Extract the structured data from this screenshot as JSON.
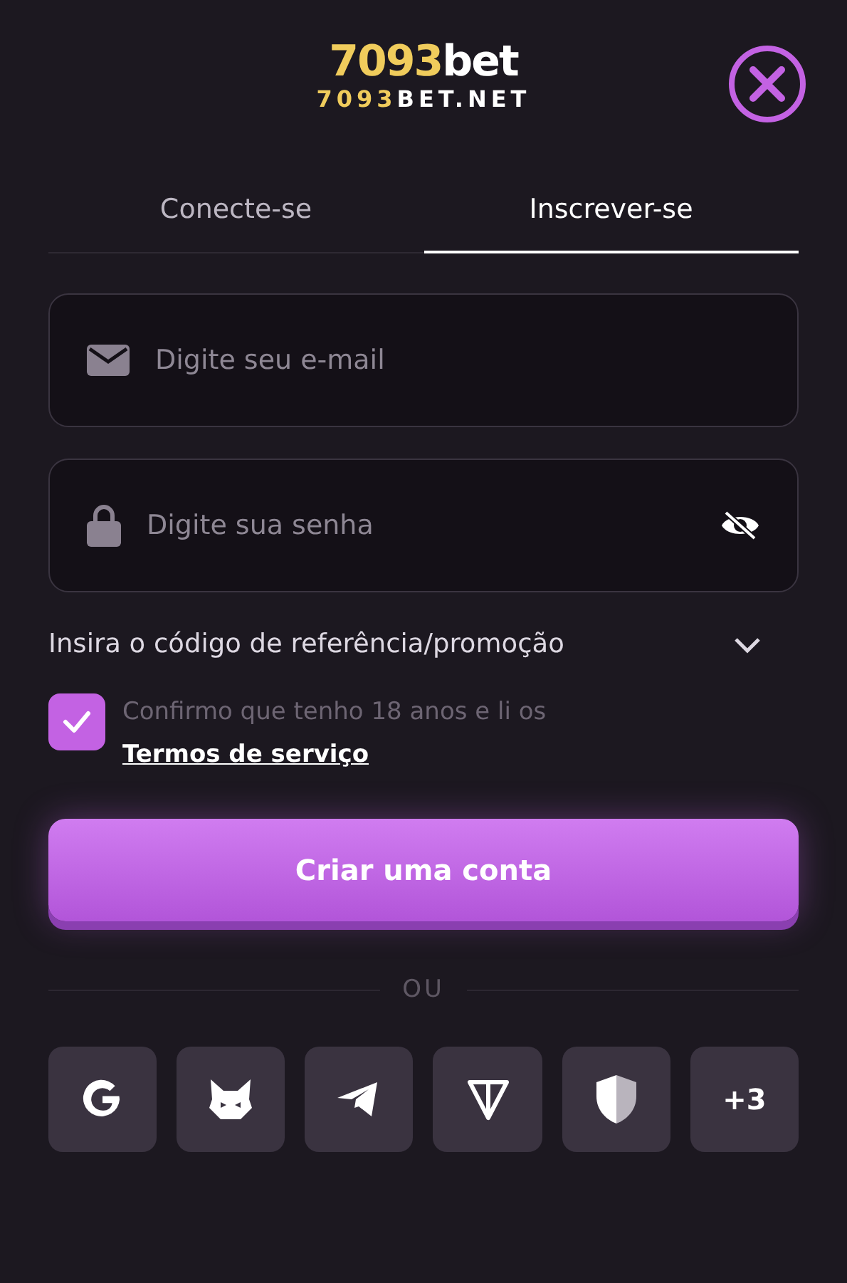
{
  "logo": {
    "brand_number": "7093",
    "brand_suffix": "bet",
    "domain_number": "7093",
    "domain_suffix": "BET.NET"
  },
  "tabs": [
    {
      "label": "Conecte-se",
      "selected": false
    },
    {
      "label": "Inscrever-se",
      "selected": true
    }
  ],
  "fields": [
    {
      "kind": "email",
      "placeholder": "Digite seu e-mail"
    },
    {
      "kind": "password",
      "placeholder": "Digite sua senha"
    }
  ],
  "referral": {
    "label": "Insira o código de referência/promoção",
    "expanded": false
  },
  "consent": {
    "checked": true,
    "text": "Confirmo que tenho 18 anos e li os",
    "link": "Termos de serviço"
  },
  "submit_button": "Criar uma conta",
  "divider_text": "OU",
  "social": [
    {
      "kind": "google"
    },
    {
      "kind": "fox"
    },
    {
      "kind": "telegram"
    },
    {
      "kind": "ton"
    },
    {
      "kind": "shield"
    },
    {
      "kind": "more",
      "label": "+3"
    }
  ]
}
